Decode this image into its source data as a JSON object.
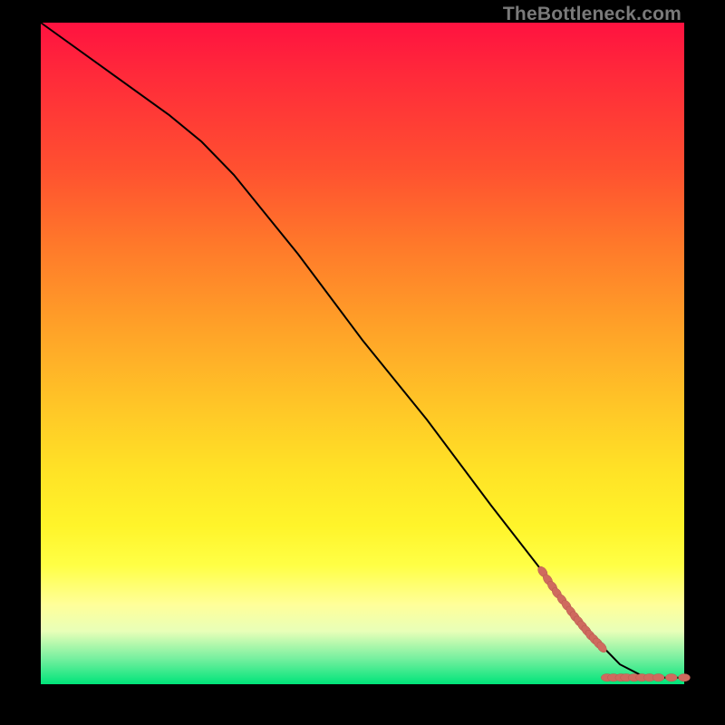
{
  "watermark": "TheBottleneck.com",
  "colors": {
    "curve": "#000000",
    "marker_fill": "#cf6a5e",
    "marker_stroke": "#b85a50",
    "bg_black": "#000000"
  },
  "chart_data": {
    "type": "line",
    "title": "",
    "xlabel": "",
    "ylabel": "",
    "xlim": [
      0,
      100
    ],
    "ylim": [
      0,
      100
    ],
    "grid": false,
    "series": [
      {
        "name": "curve",
        "style": "solid-black",
        "x": [
          0,
          10,
          20,
          25,
          30,
          40,
          50,
          60,
          70,
          78,
          82,
          85,
          88,
          90,
          92,
          94,
          96,
          98,
          100
        ],
        "y": [
          100,
          93,
          86,
          82,
          77,
          65,
          52,
          40,
          27,
          17,
          12,
          8,
          5,
          3,
          2,
          1,
          1,
          1,
          1
        ]
      }
    ],
    "markers": [
      {
        "name": "tail-dash-cluster",
        "shape": "circle",
        "color": "#cf6a5e",
        "points": [
          {
            "x": 78.0,
            "y": 17.0
          },
          {
            "x": 78.8,
            "y": 15.8
          },
          {
            "x": 79.5,
            "y": 14.8
          },
          {
            "x": 80.2,
            "y": 13.8
          },
          {
            "x": 81.0,
            "y": 12.8
          },
          {
            "x": 81.7,
            "y": 11.9
          },
          {
            "x": 82.4,
            "y": 11.0
          },
          {
            "x": 83.0,
            "y": 10.2
          },
          {
            "x": 83.6,
            "y": 9.5
          },
          {
            "x": 84.2,
            "y": 8.8
          },
          {
            "x": 84.8,
            "y": 8.1
          },
          {
            "x": 85.4,
            "y": 7.4
          },
          {
            "x": 86.0,
            "y": 6.8
          },
          {
            "x": 86.6,
            "y": 6.2
          },
          {
            "x": 87.2,
            "y": 5.6
          },
          {
            "x": 88.0,
            "y": 1.0
          },
          {
            "x": 89.0,
            "y": 1.0
          },
          {
            "x": 90.2,
            "y": 1.0
          },
          {
            "x": 91.0,
            "y": 1.0
          },
          {
            "x": 92.2,
            "y": 1.0
          },
          {
            "x": 93.4,
            "y": 1.0
          },
          {
            "x": 94.6,
            "y": 1.0
          },
          {
            "x": 96.0,
            "y": 1.0
          },
          {
            "x": 98.0,
            "y": 1.0
          },
          {
            "x": 100.0,
            "y": 1.0
          }
        ]
      }
    ]
  }
}
